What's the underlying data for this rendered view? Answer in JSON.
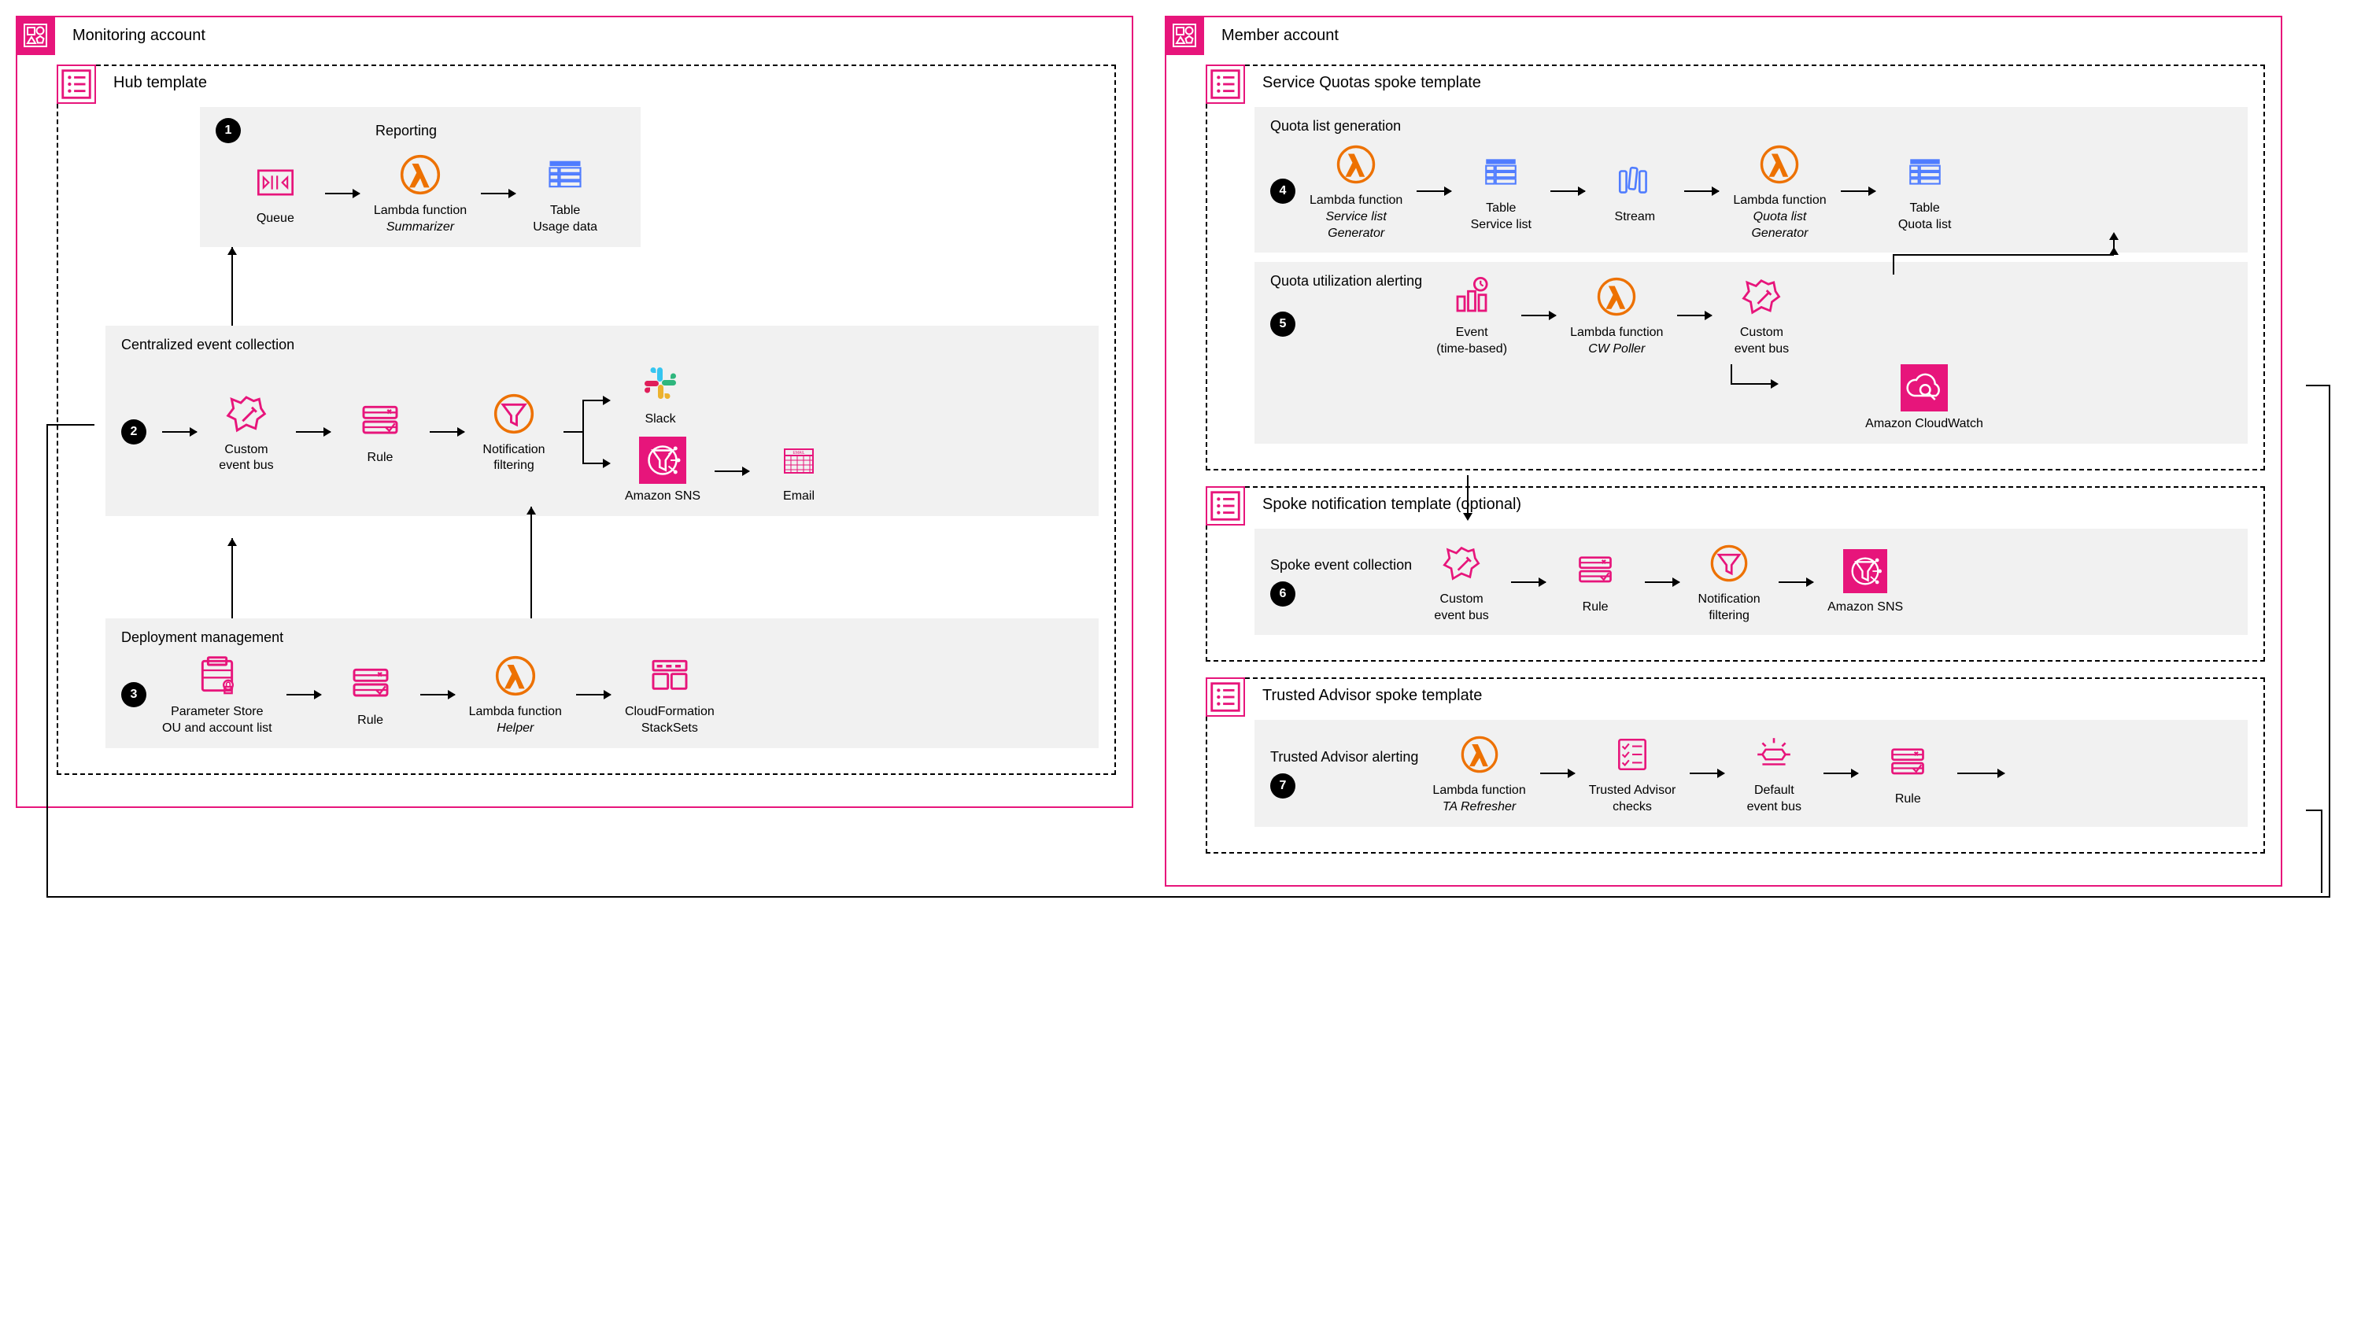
{
  "accounts": {
    "monitoring": {
      "title": "Monitoring account"
    },
    "member": {
      "title": "Member account"
    }
  },
  "templates": {
    "hub": {
      "title": "Hub template"
    },
    "sq_spoke": {
      "title": "Service Quotas spoke template"
    },
    "spoke_notif": {
      "title": "Spoke notification template (optional)"
    },
    "ta_spoke": {
      "title": "Trusted Advisor spoke template"
    }
  },
  "sections": {
    "reporting": {
      "num": "1",
      "title": "Reporting"
    },
    "cec": {
      "num": "2",
      "title": "Centralized event collection"
    },
    "deploy": {
      "num": "3",
      "title": "Deployment management"
    },
    "qlg": {
      "num": "4",
      "title": "Quota list generation"
    },
    "qua": {
      "num": "5",
      "title": "Quota utilization alerting"
    },
    "sec": {
      "num": "6",
      "title": "Spoke event collection"
    },
    "taa": {
      "num": "7",
      "title": "Trusted Advisor alerting"
    }
  },
  "nodes": {
    "queue": {
      "l1": "Queue"
    },
    "summarizer": {
      "l1": "Lambda function",
      "l2": "Summarizer"
    },
    "usage_table": {
      "l1": "Table",
      "l2": "Usage data"
    },
    "custom_bus": {
      "l1": "Custom",
      "l2": "event bus"
    },
    "rule": {
      "l1": "Rule"
    },
    "notif_filter": {
      "l1": "Notification",
      "l2": "filtering"
    },
    "slack": {
      "l1": "Slack"
    },
    "sns": {
      "l1": "Amazon SNS"
    },
    "email": {
      "l1": "Email"
    },
    "param_store": {
      "l1": "Parameter Store",
      "l2": "OU and account list"
    },
    "helper": {
      "l1": "Lambda function",
      "l2": "Helper"
    },
    "cfn": {
      "l1": "CloudFormation",
      "l2": "StackSets"
    },
    "svc_gen": {
      "l1": "Lambda function",
      "l2": "Service list",
      "l3": "Generator"
    },
    "svc_table": {
      "l1": "Table",
      "l2": "Service list"
    },
    "stream": {
      "l1": "Stream"
    },
    "quota_gen": {
      "l1": "Lambda function",
      "l2": "Quota list",
      "l3": "Generator"
    },
    "quota_table": {
      "l1": "Table",
      "l2": "Quota list"
    },
    "event_time": {
      "l1": "Event",
      "l2": "(time-based)"
    },
    "cw_poller": {
      "l1": "Lambda function",
      "l2": "CW Poller"
    },
    "cloudwatch": {
      "l1": "Amazon CloudWatch"
    },
    "ta_refresher": {
      "l1": "Lambda function",
      "l2": "TA Refresher"
    },
    "ta_checks": {
      "l1": "Trusted Advisor",
      "l2": "checks"
    },
    "default_bus": {
      "l1": "Default",
      "l2": "event bus"
    }
  }
}
